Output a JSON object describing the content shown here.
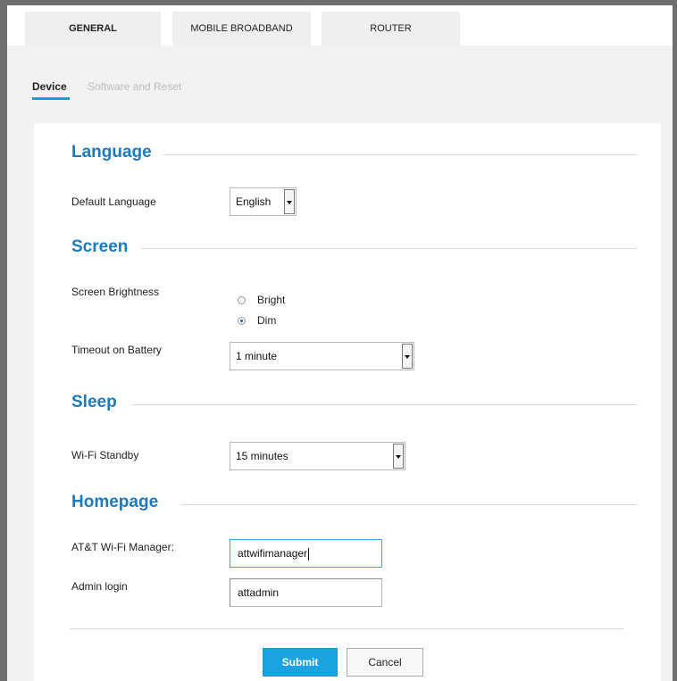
{
  "tabs": [
    {
      "label": "GENERAL",
      "active": true
    },
    {
      "label": "MOBILE BROADBAND",
      "active": false
    },
    {
      "label": "ROUTER",
      "active": false
    }
  ],
  "subtabs": [
    {
      "label": "Device",
      "active": true
    },
    {
      "label": "Software and Reset",
      "active": false
    }
  ],
  "sections": {
    "language": {
      "title": "Language",
      "default_language_label": "Default Language",
      "default_language_value": "English"
    },
    "screen": {
      "title": "Screen",
      "brightness_label": "Screen Brightness",
      "brightness_options": [
        {
          "label": "Bright",
          "checked": false
        },
        {
          "label": "Dim",
          "checked": true
        }
      ],
      "timeout_label": "Timeout on Battery",
      "timeout_value": "1 minute"
    },
    "sleep": {
      "title": "Sleep",
      "wifi_standby_label": "Wi-Fi Standby",
      "wifi_standby_value": "15 minutes"
    },
    "homepage": {
      "title": "Homepage",
      "manager_label": "AT&T Wi-Fi Manager:",
      "manager_value": "attwifimanager",
      "admin_label": "Admin login",
      "admin_value": "attadmin"
    }
  },
  "actions": {
    "submit_label": "Submit",
    "cancel_label": "Cancel"
  },
  "colors": {
    "accent": "#1a7bbf",
    "button_primary": "#1aa3de",
    "subtab_underline": "#1a9ad6"
  }
}
